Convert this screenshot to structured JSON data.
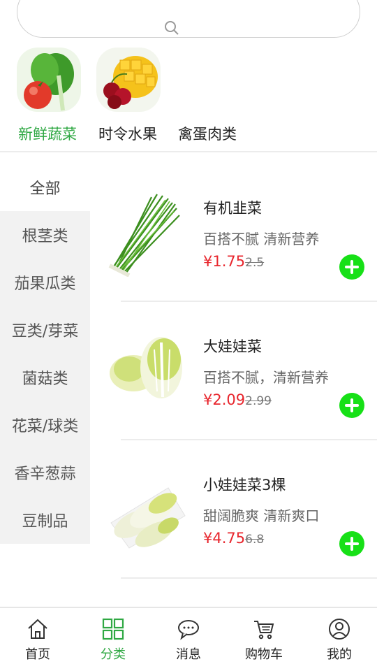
{
  "search": {
    "placeholder": ""
  },
  "top_categories": [
    {
      "label": "新鲜蔬菜",
      "active": true
    },
    {
      "label": "时令水果",
      "active": false
    },
    {
      "label": "禽蛋肉类",
      "active": false
    }
  ],
  "side_menu": [
    {
      "label": "全部",
      "active": true
    },
    {
      "label": "根茎类",
      "active": false
    },
    {
      "label": "茄果瓜类",
      "active": false
    },
    {
      "label": "豆类/芽菜",
      "active": false
    },
    {
      "label": "菌菇类",
      "active": false
    },
    {
      "label": "花菜/球类",
      "active": false
    },
    {
      "label": "香辛葱蒜",
      "active": false
    },
    {
      "label": "豆制品",
      "active": false
    }
  ],
  "products": [
    {
      "name": "有机韭菜",
      "desc": "百搭不腻 清新营养",
      "price": "¥1.75",
      "old_price": "2.5",
      "image": "chives"
    },
    {
      "name": "大娃娃菜",
      "desc": "百搭不腻，清新营养",
      "price": "¥2.09",
      "old_price": "2.99",
      "image": "napa-cabbage"
    },
    {
      "name": "小娃娃菜3棵",
      "desc": "甜阔脆爽 清新爽口",
      "price": "¥4.75",
      "old_price": "6.8",
      "image": "baby-cabbage"
    }
  ],
  "tabbar": [
    {
      "label": "首页",
      "icon": "home-icon",
      "active": false
    },
    {
      "label": "分类",
      "icon": "grid-icon",
      "active": true
    },
    {
      "label": "消息",
      "icon": "message-icon",
      "active": false
    },
    {
      "label": "购物车",
      "icon": "cart-icon",
      "active": false
    },
    {
      "label": "我的",
      "icon": "user-icon",
      "active": false
    }
  ],
  "colors": {
    "accent": "#2fa843",
    "price": "#e8262d",
    "add_button": "#17e017",
    "side_bg": "#f2f2f2"
  }
}
